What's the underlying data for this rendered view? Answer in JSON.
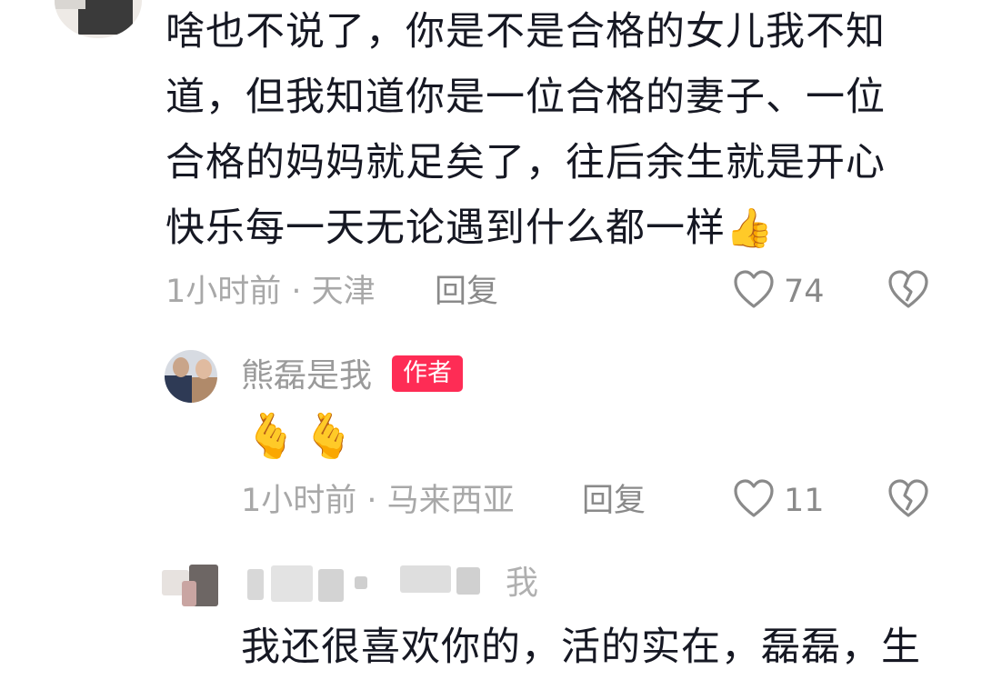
{
  "comments": [
    {
      "text_lines": [
        "啥也不说了，你是不是合格的女儿我不知",
        "道，但我知道你是一位合格的妻子、一位",
        "合格的妈妈就足矣了，往后余生就是开心",
        "快乐每一天无论遇到什么都一样"
      ],
      "trailing_emoji": "👍",
      "time_location": "1小时前 · 天津",
      "reply_label": "回复",
      "like_count": "74"
    },
    {
      "username": "熊磊是我",
      "badge": "作者",
      "emoji_text": "🫰🫰",
      "time_location": "1小时前 · 马来西亚",
      "reply_label": "回复",
      "like_count": "11"
    },
    {
      "username_fragment": "我",
      "partial_text": "我还很喜欢你的，活的实在，磊磊，生"
    }
  ],
  "icons": {
    "like": "heart-outline-icon",
    "dislike": "broken-heart-icon"
  }
}
